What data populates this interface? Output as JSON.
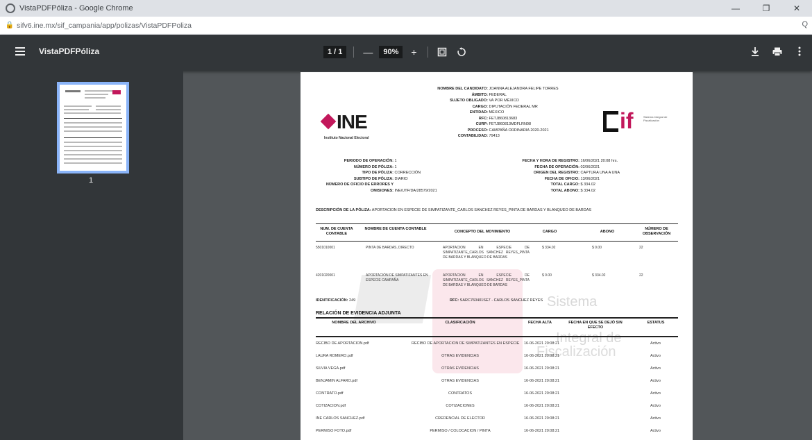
{
  "window": {
    "title": "VistaPDFPóliza - Google Chrome",
    "controls": [
      "—",
      "❐",
      "✕"
    ]
  },
  "address": {
    "url": "sifv6.ine.mx/sif_campania/app/polizas/VistaPDFPoliza",
    "zoom_icon": "Q"
  },
  "viewer": {
    "doc_title": "VistaPDFPóliza",
    "page_indicator": "1 / 1",
    "zoom": "90%",
    "minus": "—",
    "plus": "+",
    "thumbnail_page": "1"
  },
  "page": {
    "ine_word": "INE",
    "ine_sub": "Instituto Nacional Electoral",
    "sif_text": "Sistema Integral de Fiscalización",
    "header": [
      {
        "label": "NOMBRE DEL CANDIDATO:",
        "value": "JOANNA ALEJANDRA FELIPE TORRES"
      },
      {
        "label": "ÁMBITO:",
        "value": "FEDERAL"
      },
      {
        "label": "SUJETO OBLIGADO:",
        "value": "VA POR MÉXICO"
      },
      {
        "label": "CARGO:",
        "value": "DIPUTACIÓN FEDERAL MR"
      },
      {
        "label": "ENTIDAD:",
        "value": "MÉXICO"
      },
      {
        "label": "RFC:",
        "value": "FETJ860813683"
      },
      {
        "label": "CURP:",
        "value": "FETJ860813MDFLRN08"
      },
      {
        "label": "PROCESO:",
        "value": "CAMPAÑA ORDINARIA 2020-2021"
      },
      {
        "label": "CONTABILIDAD:",
        "value": "79413"
      }
    ],
    "left_info": [
      {
        "label": "PERIODO DE OPERACIÓN:",
        "value": "1"
      },
      {
        "label": "NÚMERO DE PÓLIZA:",
        "value": "1"
      },
      {
        "label": "TIPO DE PÓLIZA:",
        "value": "CORRECCIÓN"
      },
      {
        "label": "SUBTIPO DE PÓLIZA:",
        "value": "DIARIO"
      },
      {
        "label": "NÚMERO DE OFICIO DE ERRORES Y",
        "value": ""
      },
      {
        "label": "OMISIONES:",
        "value": "INE/UTF/DA/28579/2021"
      }
    ],
    "right_info": [
      {
        "label": "FECHA Y HORA DE REGISTRO:",
        "value": "16/06/2021 20:08 hrs."
      },
      {
        "label": "FECHA DE OPERACIÓN:",
        "value": "02/06/2021"
      },
      {
        "label": "ORIGEN DEL REGISTRO:",
        "value": "CAPTURA UNA A UNA"
      },
      {
        "label": "FECHA DE OFICIO:",
        "value": "13/06/2021"
      },
      {
        "label": "TOTAL CARGO:",
        "value": "$ 334.02"
      },
      {
        "label": "TOTAL ABONO:",
        "value": "$ 334.02"
      }
    ],
    "description_label": "DESCRIPCIÓN DE LA PÓLIZA:",
    "description_value": "APORTACION EN ESPECIE DE SIMPATIZANTE_CARLOS SANCHEZ REYES_PINTA DE BARDAS Y BLANQUEO DE BARDAS",
    "table_headers": [
      "NUM. DE CUENTA CONTABLE",
      "NOMBRE DE CUENTA CONTABLE",
      "CONCEPTO DEL MOVIMIENTO",
      "CARGO",
      "ABONO",
      "NÚMERO DE OBSERVACIÓN"
    ],
    "table_rows": [
      {
        "num": "5501010001",
        "name": "PINTA DE BARDAS, DIRECTO",
        "concept": "APORTACION EN ESPECIE DE SIMPATIZANTE_CARLOS SANCHEZ REYES_PINTA DE BARDAS Y BLANQUEO DE BARDAS",
        "cargo": "$ 334.02",
        "abono": "$ 0.00",
        "obs": "22"
      },
      {
        "num": "4201020001",
        "name": "APORTACIÓN DE SIMPATIZANTES EN ESPECIE CAMPAÑA",
        "concept": "APORTACION EN ESPECIE DE SIMPATIZANTE_CARLOS SANCHEZ REYES_PINTA DE BARDAS Y BLANQUEO DE BARDAS",
        "cargo": "$ 0.00",
        "abono": "$ 334.02",
        "obs": "22"
      }
    ],
    "identificacion_label": "IDENTIFICACIÓN:",
    "identificacion_value": "249",
    "rfc_label": "RFC:",
    "rfc_value": "SARC760401SE7 - CARLOS SANCHEZ REYES",
    "evidence_title": "RELACIÓN DE EVIDENCIA ADJUNTA",
    "evidence_headers": [
      "NOMBRE DEL ARCHIVO",
      "CLASIFICACIÓN",
      "FECHA ALTA",
      "FECHA EN QUE SE DEJÓ SIN EFECTO",
      "ESTATUS"
    ],
    "evidence_rows": [
      {
        "file": "RECIBO DE APORTACION.pdf",
        "class": "RECIBO DE APORTACION DE SIMPATIZANTES EN ESPECIE",
        "date": "16-06-2021 20:08:21",
        "status": "Activo"
      },
      {
        "file": "LAURA ROMERO.pdf",
        "class": "OTRAS EVIDENCIAS",
        "date": "16-06-2021 20:08:21",
        "status": "Activo"
      },
      {
        "file": "SILVIA VEGA.pdf",
        "class": "OTRAS EVIDENCIAS",
        "date": "16-06-2021 20:08:21",
        "status": "Activo"
      },
      {
        "file": "BENJAMIN ALFARO.pdf",
        "class": "OTRAS EVIDENCIAS",
        "date": "16-06-2021 20:08:21",
        "status": "Activo"
      },
      {
        "file": "CONTRATO.pdf",
        "class": "CONTRATOS",
        "date": "16-06-2021 20:08:21",
        "status": "Activo"
      },
      {
        "file": "COTIZACION.pdf",
        "class": "COTIZACIONES",
        "date": "16-06-2021 20:08:21",
        "status": "Activo"
      },
      {
        "file": "INE CARLOS SANCHEZ.pdf",
        "class": "CREDENCIAL DE ELECTOR",
        "date": "16-06-2021 20:08:21",
        "status": "Activo"
      },
      {
        "file": "PERMISO FOTO.pdf",
        "class": "PERMISO / COLOCACION / PINTA",
        "date": "16-06-2021 20:08:21",
        "status": "Activo"
      }
    ],
    "watermark": [
      "Sistema",
      "Integral de",
      "Fiscalización"
    ]
  },
  "icons": {
    "menu": "hamburger-icon",
    "download": "download-icon",
    "print": "print-icon",
    "more": "more-vert-icon",
    "fit": "fit-page-icon",
    "rotate": "rotate-icon"
  }
}
